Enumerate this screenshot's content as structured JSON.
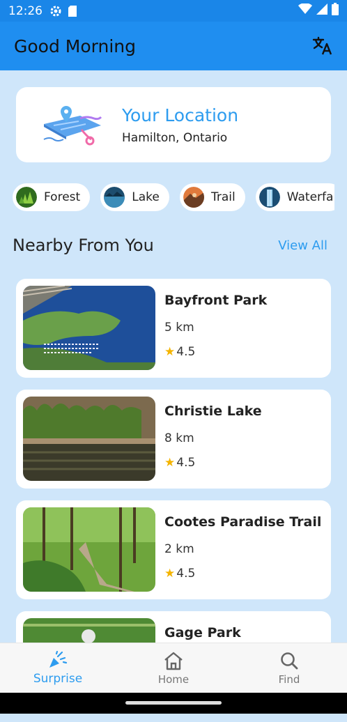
{
  "status_bar": {
    "time": "12:26"
  },
  "app_bar": {
    "title": "Good Morning"
  },
  "location": {
    "title": "Your Location",
    "city": "Hamilton, Ontario"
  },
  "categories": [
    {
      "label": "Forest"
    },
    {
      "label": "Lake"
    },
    {
      "label": "Trail"
    },
    {
      "label": "Waterfa"
    }
  ],
  "nearby": {
    "title": "Nearby From You",
    "view_all": "View All",
    "places": [
      {
        "name": "Bayfront Park",
        "distance": "5 km",
        "rating": "4.5"
      },
      {
        "name": "Christie Lake",
        "distance": "8 km",
        "rating": "4.5"
      },
      {
        "name": "Cootes Paradise Trail",
        "distance": "2 km",
        "rating": "4.5"
      },
      {
        "name": "Gage Park",
        "distance": "",
        "rating": ""
      }
    ]
  },
  "bottom_nav": {
    "items": [
      {
        "label": "Surprise",
        "icon": "party-popper-icon",
        "active": true
      },
      {
        "label": "Home",
        "icon": "home-icon",
        "active": false
      },
      {
        "label": "Find",
        "icon": "search-icon",
        "active": false
      }
    ]
  },
  "colors": {
    "primary": "#1f8ef0",
    "accent": "#2d9cef",
    "background": "#cfe6fa",
    "star": "#f4b400"
  }
}
